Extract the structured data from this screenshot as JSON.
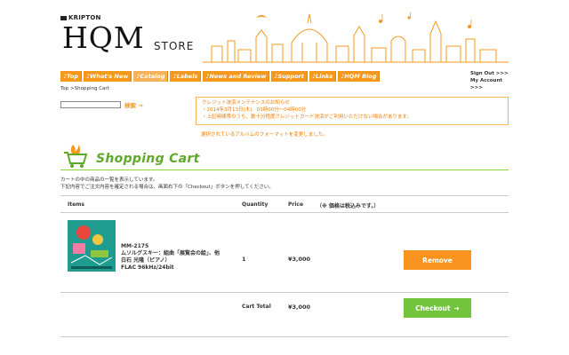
{
  "header": {
    "brand_small": "KRIPTON",
    "logo_main": "HQM",
    "logo_store": "STORE"
  },
  "nav": [
    {
      "label": "♪Top"
    },
    {
      "label": "♪What's New"
    },
    {
      "label": "♪Catalog"
    },
    {
      "label": "♪Labels"
    },
    {
      "label": "♪News and Review"
    },
    {
      "label": "♪Support"
    },
    {
      "label": "♪Links"
    },
    {
      "label": "♪HQM Blog"
    }
  ],
  "account": {
    "signout": "Sign Out >>>",
    "myaccount": "My Account >>>"
  },
  "breadcrumb": "Top >Shopping Cart",
  "search": {
    "button_label": "検索 →",
    "value": ""
  },
  "notice": {
    "line1": "クレジット決済メンテナンスのお知らせ",
    "line2": "・2014年3月13日(木)　03時00分～04時00分",
    "line3": "・上記時間帯のうち、数十分程度クレジットカード決済がご利用いただけない場合があります。"
  },
  "format_note": "選択されているアルバムのフォーマットを変更しました。",
  "cart": {
    "title": "Shopping Cart",
    "intro_line1": "カートの中の商品の一覧を表示しています。",
    "intro_line2": "下記内容でご注文内容を確定される場合は、画面右下の「Checkout」ボタンを押してください。",
    "columns": {
      "items": "Items",
      "quantity": "Quantity",
      "price": "Price",
      "tax_note": "（※ 価格は税込みです。）"
    },
    "items": [
      {
        "code": "MM-2175",
        "title_line1": "ムソルグスキー：組曲「展覧会の絵」、他",
        "title_line2": "白石 光隆（ピアノ）",
        "format": "FLAC 96kHz/24bit",
        "quantity": "1",
        "price": "¥3,000",
        "remove_label": "Remove"
      }
    ],
    "total_label": "Cart Total",
    "total_value": "¥3,000",
    "checkout_label": "Checkout"
  },
  "colors": {
    "nav_orange": "#f4981e",
    "notice_orange": "#ee7b00",
    "title_green": "#5fa92a",
    "remove_orange": "#f7931e",
    "checkout_green": "#72c43c"
  }
}
